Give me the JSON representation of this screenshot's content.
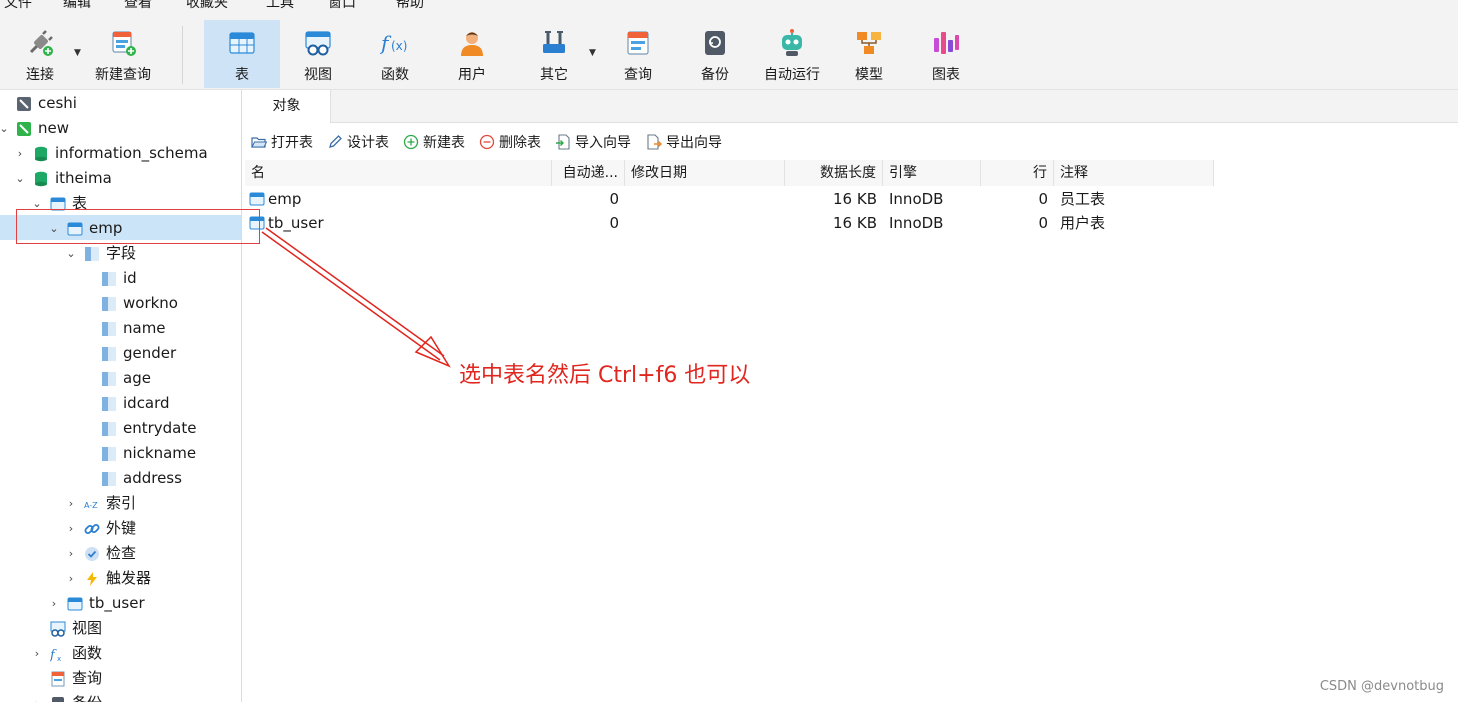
{
  "menu": [
    "文件",
    "编辑",
    "查看",
    "收藏夹",
    "工具",
    "窗口",
    "帮助"
  ],
  "toolbar": {
    "connect": "连接",
    "new_query": "新建查询",
    "table": "表",
    "view": "视图",
    "function": "函数",
    "user": "用户",
    "other": "其它",
    "query": "查询",
    "backup": "备份",
    "automation": "自动运行",
    "model": "模型",
    "chart": "图表"
  },
  "tree": {
    "ceshi": "ceshi",
    "new": "new",
    "information_schema": "information_schema",
    "itheima": "itheima",
    "tables": "表",
    "emp": "emp",
    "fields": "字段",
    "field_items": [
      "id",
      "workno",
      "name",
      "gender",
      "age",
      "idcard",
      "entrydate",
      "nickname",
      "address"
    ],
    "indexes": "索引",
    "foreign_keys": "外键",
    "checks": "检查",
    "triggers": "触发器",
    "tb_user": "tb_user",
    "views": "视图",
    "functions": "函数",
    "queries": "查询",
    "backups": "备份"
  },
  "tabs": {
    "objects": "对象"
  },
  "objbar": {
    "open_table": "打开表",
    "design_table": "设计表",
    "new_table": "新建表",
    "delete_table": "删除表",
    "import_wizard": "导入向导",
    "export_wizard": "导出向导"
  },
  "grid": {
    "headers": [
      "名",
      "自动递...",
      "修改日期",
      "数据长度",
      "引擎",
      "行",
      "注释"
    ],
    "rows": [
      [
        "emp",
        "0",
        "",
        "16 KB",
        "InnoDB",
        "0",
        "员工表"
      ],
      [
        "tb_user",
        "0",
        "",
        "16 KB",
        "InnoDB",
        "0",
        "用户表"
      ]
    ]
  },
  "annotation": "选中表名然后 Ctrl+f6 也可以",
  "watermark": "CSDN @devnotbug",
  "colors": {
    "accent": "#0a84d6",
    "selection": "#cce4f7",
    "annotation": "#e0261e",
    "db_green": "#1ea866"
  }
}
